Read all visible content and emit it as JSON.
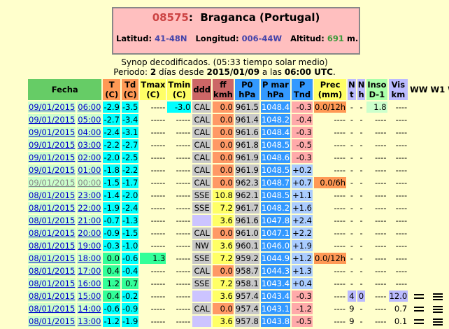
{
  "station": {
    "code": "08575",
    "name": "Braganca (Portugal)",
    "lat_label": "Latitud:",
    "lat": "41-48N",
    "lon_label": "Longitud:",
    "lon": "006-44W",
    "alt_label": "Altitud:",
    "alt": "691",
    "alt_unit": "m."
  },
  "caption": {
    "line1": "Synop decodificados. (05:33 tiempo solar medio)",
    "line2_pre": "Periodo:",
    "days": "2",
    "line2_mid": "días desde",
    "start_date": "2015/01/09",
    "line2_a": "a las",
    "start_time": "06:00 UTC",
    "period_end": "."
  },
  "headers": {
    "fecha": "Fecha",
    "t": [
      "T",
      "(C)"
    ],
    "td": [
      "Td",
      "(C)"
    ],
    "tmax": [
      "Tmax",
      "(C)"
    ],
    "tmin": [
      "Tmin",
      "(C)"
    ],
    "ddd": "ddd",
    "ff": [
      "ff",
      "kmh"
    ],
    "p0": [
      "P0",
      "hPa"
    ],
    "pmar": [
      "P mar",
      "hPa"
    ],
    "ptnd": [
      "P",
      "Tnd"
    ],
    "prec": [
      "Prec",
      "(mm)"
    ],
    "n": [
      "N",
      "t"
    ],
    "nh": [
      "N",
      "h"
    ],
    "inso": [
      "Inso",
      "D-1"
    ],
    "vis": [
      "Vis",
      "km"
    ],
    "ww": "WW",
    "w1": "W1",
    "w2": "W2"
  },
  "colors": {
    "header_green": "#66cc66",
    "header_orange": "#ff9955",
    "header_blue": "#3399ff",
    "cal_gray": "#c8c8c8",
    "wind_orange": "#ff9966",
    "wind_yellow": "#ffff66",
    "pressure_blue": "#3399ff",
    "tnd_pink": "#ffaaaa",
    "tnd_blue": "#aaccff",
    "prec_orange": "#ff9955",
    "inso_lgreen": "#ccffcc",
    "vis_lav": "#bbbbff",
    "t_cyan": "#00ffff",
    "t_green": "#33ff99",
    "td_green": "#66ffaa"
  },
  "rows": [
    {
      "date": "09/01/2015",
      "time": "06:00",
      "old": false,
      "t": "-2.9",
      "td": "-3.5",
      "tmax": "-----",
      "tmin": "-3.0",
      "ddd": "CAL",
      "ff": "0.0",
      "p0": "961.5",
      "pmar": "1048.4",
      "ptnd": "-0.3",
      "prec": "0.0/12h",
      "n": "-",
      "nh": "-",
      "inso": "1.8",
      "vis": "----",
      "ww": "",
      "w1": "",
      "w2": "",
      "c": {
        "t": "#00ffff",
        "td": "#00ffff",
        "tmin": "#00ffff",
        "ptnd": "#ffaaaa",
        "prec": "#ff9955",
        "inso": "#ccffcc",
        "ff": "#ff9966"
      }
    },
    {
      "date": "09/01/2015",
      "time": "05:00",
      "old": false,
      "t": "-2.7",
      "td": "-3.4",
      "tmax": "-----",
      "tmin": "-----",
      "ddd": "CAL",
      "ff": "0.0",
      "p0": "961.4",
      "pmar": "1048.2",
      "ptnd": "-0.4",
      "prec": "----",
      "n": "-",
      "nh": "-",
      "inso": "----",
      "vis": "----",
      "ww": "",
      "w1": "",
      "w2": "",
      "c": {
        "t": "#00ffff",
        "td": "#00ffff",
        "ptnd": "#ffaaaa",
        "ff": "#ff9966"
      }
    },
    {
      "date": "09/01/2015",
      "time": "04:00",
      "old": false,
      "t": "-2.4",
      "td": "-3.1",
      "tmax": "-----",
      "tmin": "-----",
      "ddd": "CAL",
      "ff": "0.0",
      "p0": "961.6",
      "pmar": "1048.4",
      "ptnd": "-0.3",
      "prec": "----",
      "n": "-",
      "nh": "-",
      "inso": "----",
      "vis": "----",
      "ww": "",
      "w1": "",
      "w2": "",
      "c": {
        "t": "#00ffff",
        "td": "#00ffff",
        "ptnd": "#ffaaaa",
        "ff": "#ff9966"
      }
    },
    {
      "date": "09/01/2015",
      "time": "03:00",
      "old": false,
      "t": "-2.2",
      "td": "-2.7",
      "tmax": "-----",
      "tmin": "-----",
      "ddd": "CAL",
      "ff": "0.0",
      "p0": "961.8",
      "pmar": "1048.5",
      "ptnd": "-0.5",
      "prec": "----",
      "n": "-",
      "nh": "-",
      "inso": "----",
      "vis": "----",
      "ww": "",
      "w1": "",
      "w2": "",
      "c": {
        "t": "#00ffff",
        "td": "#00ffff",
        "ptnd": "#ffaaaa",
        "ff": "#ff9966"
      }
    },
    {
      "date": "09/01/2015",
      "time": "02:00",
      "old": false,
      "t": "-2.0",
      "td": "-2.5",
      "tmax": "-----",
      "tmin": "-----",
      "ddd": "CAL",
      "ff": "0.0",
      "p0": "961.9",
      "pmar": "1048.6",
      "ptnd": "-0.3",
      "prec": "----",
      "n": "-",
      "nh": "-",
      "inso": "----",
      "vis": "----",
      "ww": "",
      "w1": "",
      "w2": "",
      "c": {
        "t": "#00ffff",
        "td": "#00ffff",
        "ptnd": "#ffaaaa",
        "ff": "#ff9966"
      }
    },
    {
      "date": "09/01/2015",
      "time": "01:00",
      "old": false,
      "t": "-1.8",
      "td": "-2.2",
      "tmax": "-----",
      "tmin": "-----",
      "ddd": "CAL",
      "ff": "0.0",
      "p0": "961.9",
      "pmar": "1048.5",
      "ptnd": "+0.2",
      "prec": "----",
      "n": "-",
      "nh": "-",
      "inso": "----",
      "vis": "----",
      "ww": "",
      "w1": "",
      "w2": "",
      "c": {
        "t": "#00ffff",
        "td": "#00ffff",
        "ptnd": "#aaccff",
        "ff": "#ff9966"
      }
    },
    {
      "date": "09/01/2015",
      "time": "00:00",
      "old": true,
      "t": "-1.5",
      "td": "-1.7",
      "tmax": "-----",
      "tmin": "-----",
      "ddd": "CAL",
      "ff": "0.0",
      "p0": "962.3",
      "pmar": "1048.7",
      "ptnd": "+0.7",
      "prec": "0.0/6h",
      "n": "-",
      "nh": "-",
      "inso": "----",
      "vis": "----",
      "ww": "",
      "w1": "",
      "w2": "",
      "c": {
        "t": "#00ffff",
        "td": "#00ffff",
        "ptnd": "#aaccff",
        "prec": "#ff9955",
        "ff": "#ff9966"
      }
    },
    {
      "date": "08/01/2015",
      "time": "23:00",
      "old": false,
      "t": "-1.4",
      "td": "-2.0",
      "tmax": "-----",
      "tmin": "-----",
      "ddd": "SSE",
      "ff": "10.8",
      "p0": "962.1",
      "pmar": "1048.5",
      "ptnd": "+1.1",
      "prec": "----",
      "n": "-",
      "nh": "-",
      "inso": "----",
      "vis": "----",
      "ww": "",
      "w1": "",
      "w2": "",
      "c": {
        "t": "#00ffff",
        "td": "#00ffff",
        "ptnd": "#aaccff",
        "ff": "#ffff66"
      }
    },
    {
      "date": "08/01/2015",
      "time": "22:00",
      "old": false,
      "t": "-1.9",
      "td": "-2.4",
      "tmax": "-----",
      "tmin": "-----",
      "ddd": "SSE",
      "ff": "7.2",
      "p0": "961.7",
      "pmar": "1048.2",
      "ptnd": "+1.6",
      "prec": "----",
      "n": "-",
      "nh": "-",
      "inso": "----",
      "vis": "----",
      "ww": "",
      "w1": "",
      "w2": "",
      "c": {
        "t": "#00ffff",
        "td": "#00ffff",
        "ptnd": "#aaccff",
        "ff": "#ffff66"
      }
    },
    {
      "date": "08/01/2015",
      "time": "21:00",
      "old": false,
      "t": "-0.7",
      "td": "-1.3",
      "tmax": "-----",
      "tmin": "-----",
      "ddd": "",
      "ff": "3.6",
      "p0": "961.6",
      "pmar": "1047.8",
      "ptnd": "+2.4",
      "prec": "----",
      "n": "-",
      "nh": "-",
      "inso": "----",
      "vis": "----",
      "ww": "",
      "w1": "",
      "w2": "",
      "c": {
        "t": "#00ffff",
        "td": "#00ffff",
        "ptnd": "#aaccff",
        "ff": "#ffff66"
      }
    },
    {
      "date": "08/01/2015",
      "time": "20:00",
      "old": false,
      "t": "-0.9",
      "td": "-1.5",
      "tmax": "-----",
      "tmin": "-----",
      "ddd": "CAL",
      "ff": "0.0",
      "p0": "961.0",
      "pmar": "1047.1",
      "ptnd": "+2.2",
      "prec": "----",
      "n": "-",
      "nh": "-",
      "inso": "----",
      "vis": "----",
      "ww": "",
      "w1": "",
      "w2": "",
      "c": {
        "t": "#00ffff",
        "td": "#00ffff",
        "ptnd": "#aaccff",
        "ff": "#ff9966"
      }
    },
    {
      "date": "08/01/2015",
      "time": "19:00",
      "old": false,
      "t": "-0.3",
      "td": "-1.0",
      "tmax": "-----",
      "tmin": "-----",
      "ddd": "NW",
      "ff": "3.6",
      "p0": "960.1",
      "pmar": "1046.0",
      "ptnd": "+1.9",
      "prec": "----",
      "n": "-",
      "nh": "-",
      "inso": "----",
      "vis": "----",
      "ww": "",
      "w1": "",
      "w2": "",
      "c": {
        "t": "#00ffff",
        "td": "#00ffff",
        "ptnd": "#aaccff",
        "ff": "#ffff66"
      }
    },
    {
      "date": "08/01/2015",
      "time": "18:00",
      "old": false,
      "t": "0.0",
      "td": "-0.6",
      "tmax": "1.3",
      "tmin": "-----",
      "ddd": "SSE",
      "ff": "7.2",
      "p0": "959.2",
      "pmar": "1044.9",
      "ptnd": "+1.2",
      "prec": "0.0/12h",
      "n": "-",
      "nh": "-",
      "inso": "----",
      "vis": "----",
      "ww": "",
      "w1": "",
      "w2": "",
      "c": {
        "t": "#33ff99",
        "td": "#00ffff",
        "tmax": "#33ff99",
        "ptnd": "#aaccff",
        "prec": "#ff9955",
        "ff": "#ffff66"
      }
    },
    {
      "date": "08/01/2015",
      "time": "17:00",
      "old": false,
      "t": "0.4",
      "td": "-0.4",
      "tmax": "-----",
      "tmin": "-----",
      "ddd": "CAL",
      "ff": "0.0",
      "p0": "958.7",
      "pmar": "1044.3",
      "ptnd": "+1.3",
      "prec": "----",
      "n": "-",
      "nh": "-",
      "inso": "----",
      "vis": "----",
      "ww": "",
      "w1": "",
      "w2": "",
      "c": {
        "t": "#33ff99",
        "td": "#00ffff",
        "ptnd": "#aaccff",
        "ff": "#ff9966"
      }
    },
    {
      "date": "08/01/2015",
      "time": "16:00",
      "old": false,
      "t": "1.2",
      "td": "0.7",
      "tmax": "-----",
      "tmin": "-----",
      "ddd": "SSE",
      "ff": "7.2",
      "p0": "958.1",
      "pmar": "1043.4",
      "ptnd": "+0.4",
      "prec": "----",
      "n": "-",
      "nh": "-",
      "inso": "----",
      "vis": "----",
      "ww": "",
      "w1": "",
      "w2": "",
      "c": {
        "t": "#33ff99",
        "td": "#33ff99",
        "ptnd": "#aaccff",
        "ff": "#ffff66"
      }
    },
    {
      "date": "08/01/2015",
      "time": "15:00",
      "old": false,
      "t": "0.4",
      "td": "-0.2",
      "tmax": "-----",
      "tmin": "-----",
      "ddd": "",
      "ff": "3.6",
      "p0": "957.4",
      "pmar": "1043.4",
      "ptnd": "-0.3",
      "prec": "----",
      "n": "4",
      "nh": "0",
      "inso": "----",
      "vis": "12.0",
      "ww": "fog",
      "w1": "fog",
      "w2": "fog",
      "c": {
        "t": "#33ff99",
        "td": "#00ffff",
        "ptnd": "#ffaaaa",
        "ff": "#ffff66",
        "n": "#bbbbff",
        "nh": "#bbbbff",
        "vis": "#bbbbff"
      }
    },
    {
      "date": "08/01/2015",
      "time": "14:00",
      "old": false,
      "t": "-0.6",
      "td": "-0.9",
      "tmax": "-----",
      "tmin": "-----",
      "ddd": "CAL",
      "ff": "0.0",
      "p0": "957.4",
      "pmar": "1043.1",
      "ptnd": "-1.2",
      "prec": "----",
      "n": "9",
      "nh": "-",
      "inso": "----",
      "vis": "0.7",
      "ww": "fog",
      "w1": "fog",
      "w2": "fog",
      "c": {
        "t": "#00ffff",
        "td": "#00ffff",
        "ptnd": "#ffaaaa",
        "ff": "#ff9966"
      }
    },
    {
      "date": "08/01/2015",
      "time": "13:00",
      "old": false,
      "t": "-1.2",
      "td": "-1.9",
      "tmax": "-----",
      "tmin": "-----",
      "ddd": "",
      "ff": "3.6",
      "p0": "957.8",
      "pmar": "1043.8",
      "ptnd": "-0.5",
      "prec": "----",
      "n": "9",
      "nh": "-",
      "inso": "----",
      "vis": "0.1",
      "ww": "fog",
      "w1": "fog",
      "w2": "fog",
      "c": {
        "t": "#00ffff",
        "td": "#00ffff",
        "ptnd": "#ffaaaa",
        "ff": "#ffff66"
      }
    }
  ]
}
